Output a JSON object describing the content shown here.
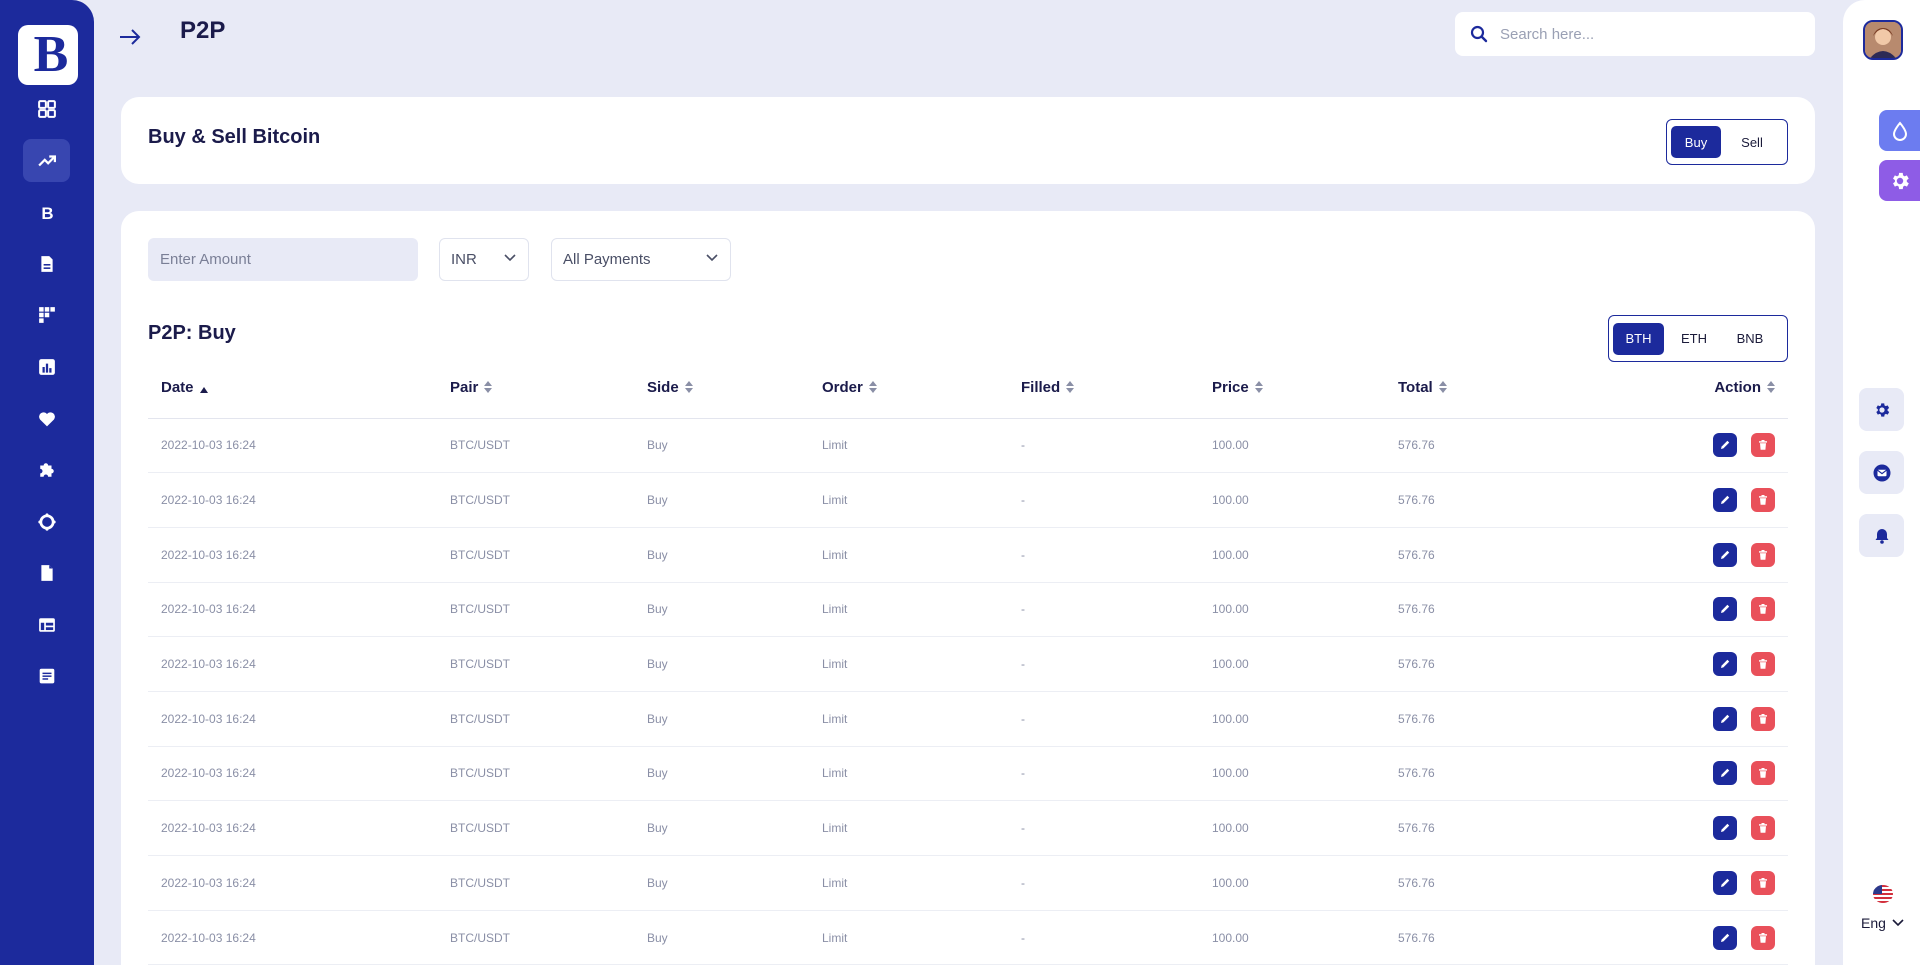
{
  "app": {
    "logo_text": "B"
  },
  "header": {
    "title": "P2P",
    "search_placeholder": "Search here..."
  },
  "sidebar": {
    "items": [
      {
        "icon": "dashboard-icon"
      },
      {
        "icon": "trending-icon",
        "active": true
      },
      {
        "icon": "bitcoin-icon"
      },
      {
        "icon": "document-icon"
      },
      {
        "icon": "grid-icon"
      },
      {
        "icon": "chart-icon"
      },
      {
        "icon": "heart-icon"
      },
      {
        "icon": "puzzle-icon"
      },
      {
        "icon": "settings-ring-icon"
      },
      {
        "icon": "file-icon"
      },
      {
        "icon": "table-icon"
      },
      {
        "icon": "list-icon"
      }
    ]
  },
  "buy_sell_card": {
    "title": "Buy & Sell Bitcoin",
    "buy_label": "Buy",
    "sell_label": "Sell",
    "active": "Buy"
  },
  "filters": {
    "amount_placeholder": "Enter Amount",
    "currency": "INR",
    "payment": "All Payments"
  },
  "orders": {
    "title": "P2P: Buy",
    "coins": [
      "BTH",
      "ETH",
      "BNB"
    ],
    "active_coin": "BTH",
    "columns": [
      "Date",
      "Pair",
      "Side",
      "Order",
      "Filled",
      "Price",
      "Total",
      "Action"
    ],
    "rows": [
      {
        "date": "2022-10-03 16:24",
        "pair": "BTC/USDT",
        "side": "Buy",
        "order": "Limit",
        "filled": "-",
        "price": "100.00",
        "total": "576.76"
      },
      {
        "date": "2022-10-03 16:24",
        "pair": "BTC/USDT",
        "side": "Buy",
        "order": "Limit",
        "filled": "-",
        "price": "100.00",
        "total": "576.76"
      },
      {
        "date": "2022-10-03 16:24",
        "pair": "BTC/USDT",
        "side": "Buy",
        "order": "Limit",
        "filled": "-",
        "price": "100.00",
        "total": "576.76"
      },
      {
        "date": "2022-10-03 16:24",
        "pair": "BTC/USDT",
        "side": "Buy",
        "order": "Limit",
        "filled": "-",
        "price": "100.00",
        "total": "576.76"
      },
      {
        "date": "2022-10-03 16:24",
        "pair": "BTC/USDT",
        "side": "Buy",
        "order": "Limit",
        "filled": "-",
        "price": "100.00",
        "total": "576.76"
      },
      {
        "date": "2022-10-03 16:24",
        "pair": "BTC/USDT",
        "side": "Buy",
        "order": "Limit",
        "filled": "-",
        "price": "100.00",
        "total": "576.76"
      },
      {
        "date": "2022-10-03 16:24",
        "pair": "BTC/USDT",
        "side": "Buy",
        "order": "Limit",
        "filled": "-",
        "price": "100.00",
        "total": "576.76"
      },
      {
        "date": "2022-10-03 16:24",
        "pair": "BTC/USDT",
        "side": "Buy",
        "order": "Limit",
        "filled": "-",
        "price": "100.00",
        "total": "576.76"
      },
      {
        "date": "2022-10-03 16:24",
        "pair": "BTC/USDT",
        "side": "Buy",
        "order": "Limit",
        "filled": "-",
        "price": "100.00",
        "total": "576.76"
      },
      {
        "date": "2022-10-03 16:24",
        "pair": "BTC/USDT",
        "side": "Buy",
        "order": "Limit",
        "filled": "-",
        "price": "100.00",
        "total": "576.76"
      }
    ]
  },
  "right_rail": {
    "language": "Eng",
    "colors": {
      "theme_tab": "#6c7cf0",
      "settings_tab": "#8e5ce6"
    }
  },
  "colors": {
    "primary": "#1c2a9c",
    "background": "#e8eaf6",
    "danger": "#e9505a"
  }
}
